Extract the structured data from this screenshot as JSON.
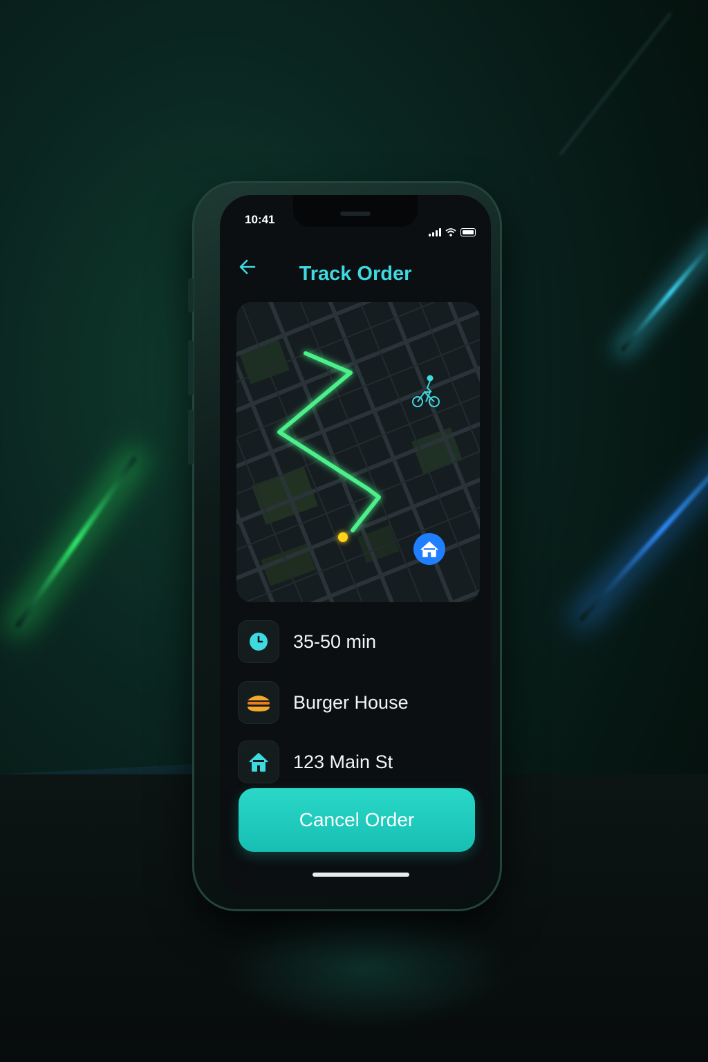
{
  "status_bar": {
    "time": "10:41"
  },
  "header": {
    "title": "Track Order",
    "back_icon": "arrow-left-icon"
  },
  "map": {
    "courier_icon": "bicycle-icon",
    "destination_icon": "home-icon",
    "route_color": "#4cf08a",
    "courier_dot_color": "#ffd21a",
    "destination_color": "#1f7fff"
  },
  "details": [
    {
      "icon": "clock-icon",
      "text": "35-50 min"
    },
    {
      "icon": "burger-icon",
      "text": "Burger House"
    },
    {
      "icon": "home-icon",
      "text": "123 Main St"
    }
  ],
  "actions": {
    "cancel_label": "Cancel Order"
  },
  "colors": {
    "accent": "#3fd9e0",
    "button": "#1fcdbf",
    "background": "#0b0f11"
  }
}
